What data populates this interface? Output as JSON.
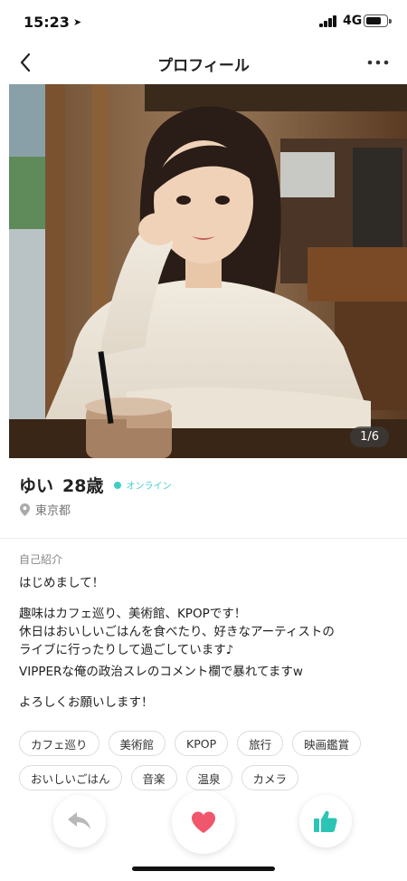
{
  "status_bar": {
    "time": "15:23",
    "network": "4G"
  },
  "nav": {
    "title": "プロフィール"
  },
  "photo": {
    "counter": "1/6"
  },
  "profile": {
    "name": "ゆい",
    "age": "28歳",
    "status": "オンライン",
    "location": "東京都"
  },
  "bio": {
    "label": "自己紹介",
    "line1": "はじめまして！",
    "line2": "趣味はカフェ巡り、美術館、KPOPです！",
    "line3": "休日はおいしいごはんを食べたり、好きなアーティストの",
    "line4": "ライブに行ったりして過ごしています♪",
    "line5": "VIPPERな俺の政治スレのコメント欄で暴れてますw",
    "line6": "よろしくお願いします！"
  },
  "tags": {
    "t1": "カフェ巡り",
    "t2": "美術館",
    "t3": "KPOP",
    "t4": "旅行",
    "t5": "映画鑑賞",
    "t6": "おいしいごはん",
    "t7": "音楽",
    "t8": "温泉",
    "t9": "カメラ"
  },
  "icons": {
    "back": "chevron-left-icon",
    "more": "more-horizontal-icon",
    "location": "location-pin-icon",
    "reply": "reply-arrow-icon",
    "like": "heart-icon",
    "thumbs_up": "thumbs-up-icon"
  },
  "colors": {
    "online": "#3ecfc4",
    "heart": "#f0566c",
    "thumbs_up": "#2cc4b4"
  }
}
